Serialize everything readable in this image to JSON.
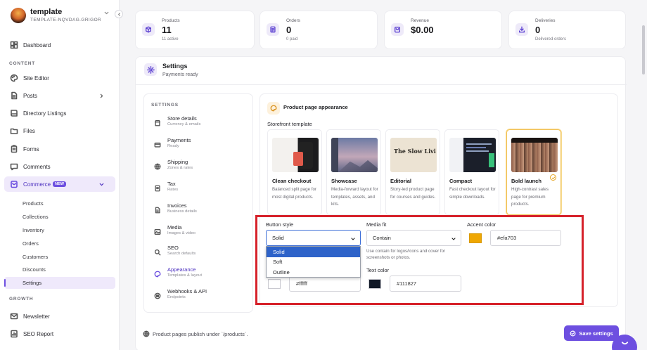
{
  "workspace": {
    "name": "template",
    "slug": "TEMPLATE-NQVDAG.GRIGOR..."
  },
  "sidebar": {
    "dashboard": "Dashboard",
    "section_content": "CONTENT",
    "content_items": [
      {
        "label": "Site Editor",
        "icon": "palette-icon"
      },
      {
        "label": "Posts",
        "icon": "document-icon"
      },
      {
        "label": "Directory Listings",
        "icon": "book-icon"
      },
      {
        "label": "Files",
        "icon": "folder-icon"
      },
      {
        "label": "Forms",
        "icon": "clipboard-icon"
      },
      {
        "label": "Comments",
        "icon": "comment-icon"
      }
    ],
    "commerce": {
      "label": "Commerce",
      "badge": "NEW"
    },
    "commerce_items": [
      "Products",
      "Collections",
      "Inventory",
      "Orders",
      "Customers",
      "Discounts",
      "Settings"
    ],
    "active_sub": "Settings",
    "section_growth": "GROWTH",
    "growth_items": [
      {
        "label": "Newsletter",
        "icon": "mail-icon"
      },
      {
        "label": "SEO Report",
        "icon": "report-icon"
      }
    ]
  },
  "stats": [
    {
      "label": "Products",
      "value": "11",
      "sub": "11 active",
      "icon": "box-icon"
    },
    {
      "label": "Orders",
      "value": "0",
      "sub": "0 paid",
      "icon": "receipt-icon"
    },
    {
      "label": "Revenue",
      "value": "$0.00",
      "sub": "",
      "icon": "wallet-icon"
    },
    {
      "label": "Deliveries",
      "value": "0",
      "sub": "Delivered orders",
      "icon": "download-icon"
    }
  ],
  "settings": {
    "title": "Settings",
    "subtitle": "Payments ready",
    "nav_heading": "SETTINGS",
    "nav": [
      {
        "title": "Store details",
        "sub": "Currency & emails",
        "icon": "store-icon"
      },
      {
        "title": "Payments",
        "sub": "Ready",
        "icon": "card-icon"
      },
      {
        "title": "Shipping",
        "sub": "Zones & rates",
        "icon": "globe-icon"
      },
      {
        "title": "Tax",
        "sub": "Rates",
        "icon": "tax-icon"
      },
      {
        "title": "Invoices",
        "sub": "Business details",
        "icon": "invoice-icon"
      },
      {
        "title": "Media",
        "sub": "Images & video",
        "icon": "image-icon"
      },
      {
        "title": "SEO",
        "sub": "Search defaults",
        "icon": "search-icon"
      },
      {
        "title": "Appearance",
        "sub": "Templates & layout",
        "icon": "palette-icon"
      },
      {
        "title": "Webhooks & API",
        "sub": "Endpoints",
        "icon": "webhook-icon"
      }
    ],
    "active_nav": "Appearance"
  },
  "appearance": {
    "title": "Product page appearance",
    "template_label": "Storefront template",
    "templates": [
      {
        "name": "Clean checkout",
        "desc": "Balanced split page for most digital products."
      },
      {
        "name": "Showcase",
        "desc": "Media-forward layout for templates, assets, and kits."
      },
      {
        "name": "Editorial",
        "desc": "Story-led product page for courses and guides."
      },
      {
        "name": "Compact",
        "desc": "Fast checkout layout for simple downloads."
      },
      {
        "name": "Bold launch",
        "desc": "High-contrast sales page for premium products."
      }
    ],
    "selected_template": "Bold launch",
    "editorial_thumb_text": "The Slow Livi Guide",
    "button_style": {
      "label": "Button style",
      "value": "Solid",
      "options": [
        "Solid",
        "Soft",
        "Outline"
      ]
    },
    "media_fit": {
      "label": "Media fit",
      "value": "Contain",
      "hint": "Use contain for logos/icons and cover for screenshots or photos."
    },
    "accent_color": {
      "label": "Accent color",
      "value": "#efa703"
    },
    "background_color": {
      "value": "#ffffff"
    },
    "text_color": {
      "label": "Text color",
      "value": "#111827"
    }
  },
  "footer": {
    "publish_note": "Product pages publish under `/products`.",
    "save_label": "Save settings"
  },
  "colors": {
    "brand": "#6d4fe0",
    "accent": "#efa703",
    "highlight_box": "#d6212a"
  }
}
